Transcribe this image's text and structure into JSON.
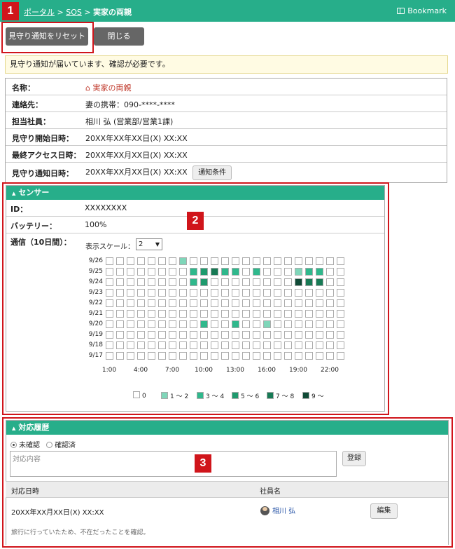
{
  "header": {
    "breadcrumb": [
      "ポータル",
      "SOS",
      "実家の両親"
    ],
    "bookmark_label": "Bookmark"
  },
  "callouts": [
    "1",
    "2",
    "3"
  ],
  "toolbar": {
    "reset_label": "見守り通知をリセット",
    "close_label": "閉じる"
  },
  "alert": "見守り通知が届いています、確認が必要です。",
  "info": {
    "rows": [
      {
        "label": "名称：",
        "value": "実家の両親"
      },
      {
        "label": "連絡先：",
        "value": "妻の携帯：090-****-****"
      },
      {
        "label": "担当社員：",
        "value": "相川 弘 (営業部/営業1課)"
      },
      {
        "label": "見守り開始日時：",
        "value": "20XX年XX年XX日(X) XX:XX"
      },
      {
        "label": "最終アクセス日時：",
        "value": "20XX年XX月XX日(X) XX:XX"
      },
      {
        "label": "見守り通知日時：",
        "value": "20XX年XX月XX日(X) XX:XX"
      }
    ],
    "condition_button": "通知条件"
  },
  "sensor": {
    "title": "センサー",
    "id_label": "ID：",
    "id_value": "XXXXXXXX",
    "battery_label": "バッテリー：",
    "battery_value": "100%",
    "comm_label": "通信（10日間）：",
    "scale_label": "表示スケール：",
    "scale_value": "2"
  },
  "chart_data": {
    "type": "heatmap",
    "rows": [
      "9/26",
      "9/25",
      "9/24",
      "9/23",
      "9/22",
      "9/21",
      "9/20",
      "9/19",
      "9/18",
      "9/17"
    ],
    "x_tick_labels": [
      "1:00",
      "4:00",
      "7:00",
      "10:00",
      "13:00",
      "16:00",
      "19:00",
      "22:00"
    ],
    "columns_per_row": 23,
    "levels": [
      [
        0,
        0,
        0,
        0,
        0,
        0,
        0,
        1,
        0,
        0,
        0,
        0,
        0,
        0,
        0,
        0,
        0,
        0,
        0,
        0,
        0,
        0,
        0
      ],
      [
        0,
        0,
        0,
        0,
        0,
        0,
        0,
        0,
        2,
        3,
        4,
        2,
        2,
        0,
        2,
        0,
        0,
        0,
        1,
        2,
        2,
        0,
        0
      ],
      [
        0,
        0,
        0,
        0,
        0,
        0,
        0,
        0,
        2,
        3,
        0,
        0,
        0,
        0,
        0,
        0,
        0,
        0,
        5,
        4,
        4,
        0,
        0
      ],
      [
        0,
        0,
        0,
        0,
        0,
        0,
        0,
        0,
        0,
        0,
        0,
        0,
        0,
        0,
        0,
        0,
        0,
        0,
        0,
        0,
        0,
        0,
        0
      ],
      [
        0,
        0,
        0,
        0,
        0,
        0,
        0,
        0,
        0,
        0,
        0,
        0,
        0,
        0,
        0,
        0,
        0,
        0,
        0,
        0,
        0,
        0,
        0
      ],
      [
        0,
        0,
        0,
        0,
        0,
        0,
        0,
        0,
        0,
        0,
        0,
        0,
        0,
        0,
        0,
        0,
        0,
        0,
        0,
        0,
        0,
        0,
        0
      ],
      [
        0,
        0,
        0,
        0,
        0,
        0,
        0,
        0,
        0,
        2,
        0,
        0,
        2,
        0,
        0,
        1,
        0,
        0,
        0,
        0,
        0,
        0,
        0
      ],
      [
        0,
        0,
        0,
        0,
        0,
        0,
        0,
        0,
        0,
        0,
        0,
        0,
        0,
        0,
        0,
        0,
        0,
        0,
        0,
        0,
        0,
        0,
        0
      ],
      [
        0,
        0,
        0,
        0,
        0,
        0,
        0,
        0,
        0,
        0,
        0,
        0,
        0,
        0,
        0,
        0,
        0,
        0,
        0,
        0,
        0,
        0,
        0
      ],
      [
        0,
        0,
        0,
        0,
        0,
        0,
        0,
        0,
        0,
        0,
        0,
        0,
        0,
        0,
        0,
        0,
        0,
        0,
        0,
        0,
        0,
        0,
        0
      ]
    ],
    "legend": [
      {
        "label": "0",
        "color": "#ffffff"
      },
      {
        "label": "1 ～ 2",
        "color": "#7fd6b9"
      },
      {
        "label": "3 ～ 4",
        "color": "#2fb88c"
      },
      {
        "label": "5 ～ 6",
        "color": "#1f9a6e"
      },
      {
        "label": "7 ～ 8",
        "color": "#177a55"
      },
      {
        "label": "9 ～",
        "color": "#0f4a36"
      }
    ]
  },
  "history": {
    "title": "対応履歴",
    "radio_unconfirmed": "未確認",
    "radio_confirmed": "確認済",
    "textarea_placeholder": "対応内容",
    "register_label": "登録",
    "col_date": "対応日時",
    "col_staff": "社員名",
    "entry": {
      "date": "20XX年XX月XX日(X) XX:XX",
      "staff": "相川 弘",
      "edit_label": "編集",
      "note": "旅行に行っていたため、不在だったことを確認。"
    }
  },
  "colors": {
    "accent": "#27ae8a",
    "callout": "#d0151b"
  }
}
